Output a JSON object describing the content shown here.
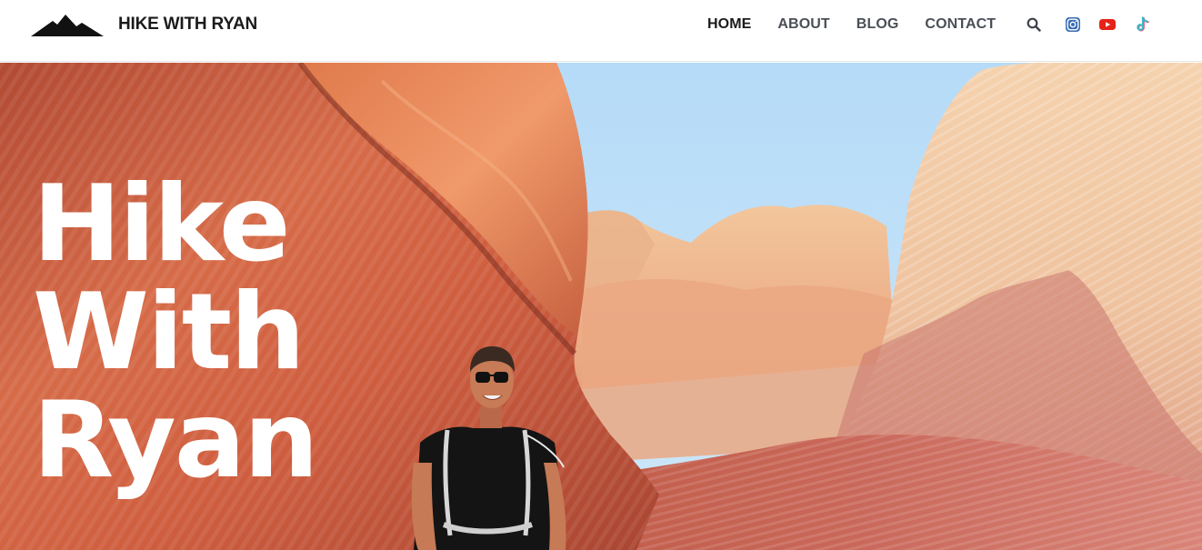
{
  "header": {
    "site_title": "HIKE WITH RYAN",
    "logo_icon": "mountain-peaks-icon",
    "nav": [
      {
        "label": "HOME",
        "active": true
      },
      {
        "label": "ABOUT",
        "active": false
      },
      {
        "label": "BLOG",
        "active": false
      },
      {
        "label": "CONTACT",
        "active": false
      }
    ],
    "icons": [
      "search-icon",
      "instagram-icon",
      "youtube-icon",
      "tiktok-icon"
    ]
  },
  "hero": {
    "title_lines": [
      "Hike",
      "With",
      "Ryan"
    ],
    "image": "hiker-in-sandstone-canyon"
  },
  "colors": {
    "text_dark": "#1b1b1b",
    "nav_text": "#4a4f57",
    "instagram": "#3b6fb6",
    "youtube": "#e62117",
    "tiktok": "#35b8c4",
    "sky": "#b9dcf7",
    "rock_red": "#c8613f",
    "rock_cream": "#f1c9a4"
  }
}
